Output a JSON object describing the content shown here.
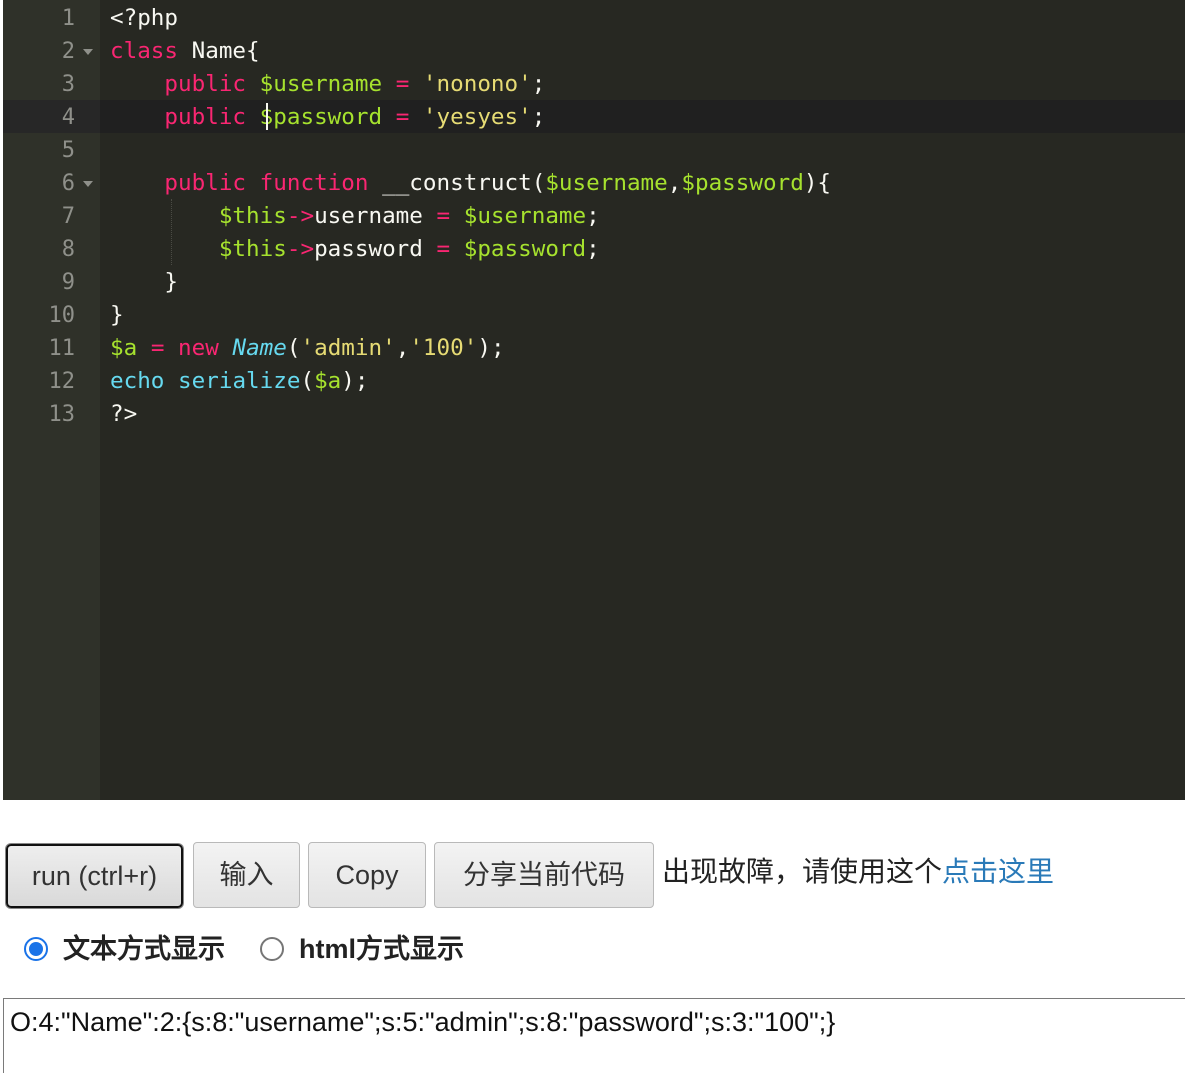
{
  "editor": {
    "line_numbers": [
      "1",
      "2",
      "3",
      "4",
      "5",
      "6",
      "7",
      "8",
      "9",
      "10",
      "11",
      "12",
      "13"
    ],
    "lines": [
      [
        {
          "t": "<?php",
          "c": "pl"
        }
      ],
      [
        {
          "t": "class",
          "c": "kw"
        },
        {
          "t": " Name{",
          "c": "pl"
        }
      ],
      [
        {
          "t": "    ",
          "c": "pl"
        },
        {
          "t": "public",
          "c": "kw"
        },
        {
          "t": " ",
          "c": "pl"
        },
        {
          "t": "$username",
          "c": "var"
        },
        {
          "t": " ",
          "c": "pl"
        },
        {
          "t": "=",
          "c": "op"
        },
        {
          "t": " ",
          "c": "pl"
        },
        {
          "t": "'nonono'",
          "c": "str"
        },
        {
          "t": ";",
          "c": "pl"
        }
      ],
      [
        {
          "t": "    ",
          "c": "pl"
        },
        {
          "t": "public",
          "c": "kw"
        },
        {
          "t": " ",
          "c": "pl"
        },
        {
          "t": "$password",
          "c": "var"
        },
        {
          "t": " ",
          "c": "pl"
        },
        {
          "t": "=",
          "c": "op"
        },
        {
          "t": " ",
          "c": "pl"
        },
        {
          "t": "'yesyes'",
          "c": "str"
        },
        {
          "t": ";",
          "c": "pl"
        }
      ],
      [],
      [
        {
          "t": "    ",
          "c": "pl"
        },
        {
          "t": "public",
          "c": "kw"
        },
        {
          "t": " ",
          "c": "pl"
        },
        {
          "t": "function",
          "c": "kw"
        },
        {
          "t": " __construct(",
          "c": "pl"
        },
        {
          "t": "$username",
          "c": "var"
        },
        {
          "t": ",",
          "c": "pl"
        },
        {
          "t": "$password",
          "c": "var"
        },
        {
          "t": "){",
          "c": "pl"
        }
      ],
      [
        {
          "t": "        ",
          "c": "pl"
        },
        {
          "t": "$this",
          "c": "var"
        },
        {
          "t": "->",
          "c": "op"
        },
        {
          "t": "username",
          "c": "pl"
        },
        {
          "t": " ",
          "c": "pl"
        },
        {
          "t": "=",
          "c": "op"
        },
        {
          "t": " ",
          "c": "pl"
        },
        {
          "t": "$username",
          "c": "var"
        },
        {
          "t": ";",
          "c": "pl"
        }
      ],
      [
        {
          "t": "        ",
          "c": "pl"
        },
        {
          "t": "$this",
          "c": "var"
        },
        {
          "t": "->",
          "c": "op"
        },
        {
          "t": "password",
          "c": "pl"
        },
        {
          "t": " ",
          "c": "pl"
        },
        {
          "t": "=",
          "c": "op"
        },
        {
          "t": " ",
          "c": "pl"
        },
        {
          "t": "$password",
          "c": "var"
        },
        {
          "t": ";",
          "c": "pl"
        }
      ],
      [
        {
          "t": "    }",
          "c": "pl"
        }
      ],
      [
        {
          "t": "}",
          "c": "pl"
        }
      ],
      [
        {
          "t": "$a",
          "c": "var"
        },
        {
          "t": " ",
          "c": "pl"
        },
        {
          "t": "=",
          "c": "op"
        },
        {
          "t": " ",
          "c": "pl"
        },
        {
          "t": "new",
          "c": "kw"
        },
        {
          "t": " ",
          "c": "pl"
        },
        {
          "t": "Name",
          "c": "cls"
        },
        {
          "t": "(",
          "c": "pl"
        },
        {
          "t": "'admin'",
          "c": "str"
        },
        {
          "t": ",",
          "c": "pl"
        },
        {
          "t": "'100'",
          "c": "str"
        },
        {
          "t": ");",
          "c": "pl"
        }
      ],
      [
        {
          "t": "echo",
          "c": "fn"
        },
        {
          "t": " ",
          "c": "pl"
        },
        {
          "t": "serialize",
          "c": "fn"
        },
        {
          "t": "(",
          "c": "pl"
        },
        {
          "t": "$a",
          "c": "var"
        },
        {
          "t": ");",
          "c": "pl"
        }
      ],
      [
        {
          "t": "?>",
          "c": "pl"
        }
      ]
    ],
    "foldable_lines": [
      2,
      6
    ],
    "active_line": 4
  },
  "toolbar": {
    "run_label": "run (ctrl+r)",
    "input_label": "输入",
    "copy_label": "Copy",
    "share_label": "分享当前代码",
    "notice_text": "出现故障，请使用这个",
    "notice_link": "点击这里"
  },
  "display_mode": {
    "text_label": "文本方式显示",
    "html_label": "html方式显示",
    "selected": "text"
  },
  "output": {
    "text": "O:4:\"Name\":2:{s:8:\"username\";s:5:\"admin\";s:8:\"password\";s:3:\"100\";}"
  },
  "colors": {
    "editor_bg": "#272822",
    "gutter_bg": "#2f3129",
    "keyword": "#f92672",
    "variable": "#a6e22e",
    "string": "#e6db74",
    "function": "#66d9ef",
    "link": "#2a7ab8",
    "radio_checked": "#1a73e8"
  }
}
